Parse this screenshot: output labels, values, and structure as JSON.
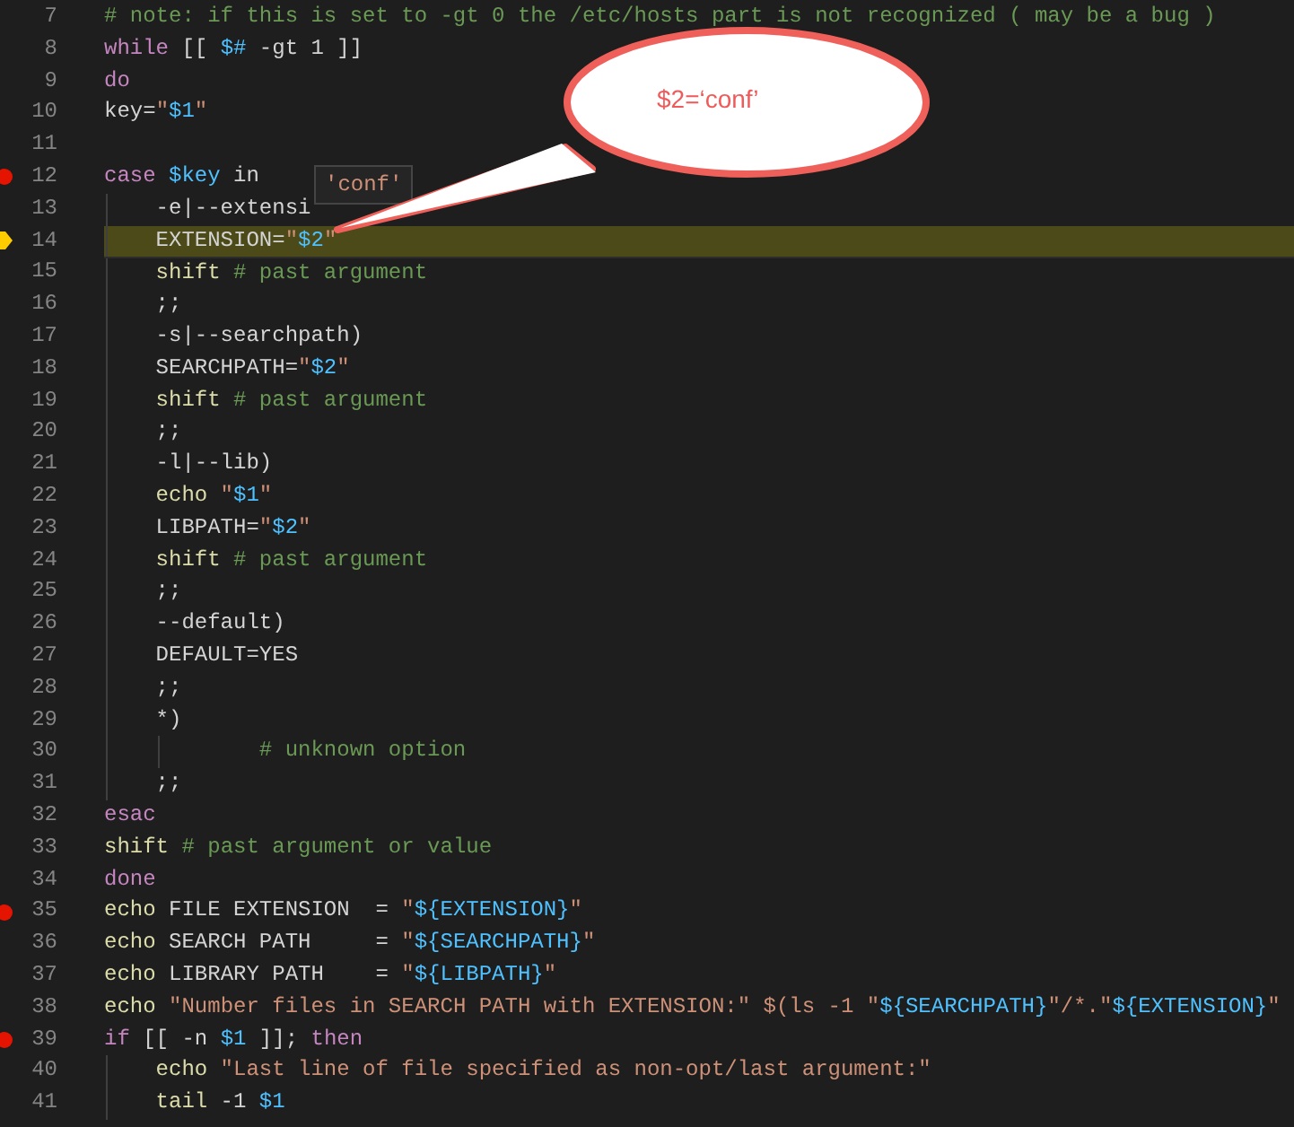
{
  "editor": {
    "lines": [
      {
        "number": "7",
        "breakpoint": false,
        "current": false,
        "segments": [
          {
            "kind": "comment",
            "text": "# note: if this is set to -gt 0 the /etc/hosts part is not recognized ( may be a bug )"
          }
        ]
      },
      {
        "number": "8",
        "breakpoint": false,
        "current": false,
        "segments": [
          {
            "kind": "keyword",
            "text": "while"
          },
          {
            "kind": "plain",
            "text": " [[ "
          },
          {
            "kind": "variable",
            "text": "$#"
          },
          {
            "kind": "plain",
            "text": " -gt 1 ]]"
          }
        ]
      },
      {
        "number": "9",
        "breakpoint": false,
        "current": false,
        "segments": [
          {
            "kind": "keyword",
            "text": "do"
          }
        ]
      },
      {
        "number": "10",
        "breakpoint": false,
        "current": false,
        "segments": [
          {
            "kind": "plain",
            "text": "key="
          },
          {
            "kind": "string",
            "text": "\""
          },
          {
            "kind": "variable",
            "text": "$1"
          },
          {
            "kind": "string",
            "text": "\""
          }
        ]
      },
      {
        "number": "11",
        "breakpoint": false,
        "current": false
      },
      {
        "number": "12",
        "breakpoint": true,
        "current": false,
        "segments": [
          {
            "kind": "keyword",
            "text": "case"
          },
          {
            "kind": "variable",
            "text": " $key"
          },
          {
            "kind": "plain",
            "text": " in"
          }
        ]
      },
      {
        "number": "13",
        "breakpoint": false,
        "current": false,
        "segments": [
          {
            "kind": "plain",
            "text": "    -e|--extensi"
          }
        ]
      },
      {
        "number": "14",
        "breakpoint": false,
        "current": true,
        "segments": [
          {
            "kind": "plain",
            "text": "    EXTENSION="
          },
          {
            "kind": "string",
            "text": "\""
          },
          {
            "kind": "variable",
            "text": "$2"
          },
          {
            "kind": "string",
            "text": "\""
          }
        ]
      },
      {
        "number": "15",
        "breakpoint": false,
        "current": false,
        "segments": [
          {
            "kind": "command",
            "text": "    shift"
          },
          {
            "kind": "comment",
            "text": " # past argument"
          }
        ]
      },
      {
        "number": "16",
        "breakpoint": false,
        "current": false,
        "segments": [
          {
            "kind": "plain",
            "text": "    ;;"
          }
        ]
      },
      {
        "number": "17",
        "breakpoint": false,
        "current": false,
        "segments": [
          {
            "kind": "plain",
            "text": "    -s|--searchpath)"
          }
        ]
      },
      {
        "number": "18",
        "breakpoint": false,
        "current": false,
        "segments": [
          {
            "kind": "plain",
            "text": "    SEARCHPATH="
          },
          {
            "kind": "string",
            "text": "\""
          },
          {
            "kind": "variable",
            "text": "$2"
          },
          {
            "kind": "string",
            "text": "\""
          }
        ]
      },
      {
        "number": "19",
        "breakpoint": false,
        "current": false,
        "segments": [
          {
            "kind": "command",
            "text": "    shift"
          },
          {
            "kind": "comment",
            "text": " # past argument"
          }
        ]
      },
      {
        "number": "20",
        "breakpoint": false,
        "current": false,
        "segments": [
          {
            "kind": "plain",
            "text": "    ;;"
          }
        ]
      },
      {
        "number": "21",
        "breakpoint": false,
        "current": false,
        "segments": [
          {
            "kind": "plain",
            "text": "    -l|--lib)"
          }
        ]
      },
      {
        "number": "22",
        "breakpoint": false,
        "current": false,
        "segments": [
          {
            "kind": "command",
            "text": "    echo"
          },
          {
            "kind": "string",
            "text": " \""
          },
          {
            "kind": "variable",
            "text": "$1"
          },
          {
            "kind": "string",
            "text": "\""
          }
        ]
      },
      {
        "number": "23",
        "breakpoint": false,
        "current": false,
        "segments": [
          {
            "kind": "plain",
            "text": "    LIBPATH="
          },
          {
            "kind": "string",
            "text": "\""
          },
          {
            "kind": "variable",
            "text": "$2"
          },
          {
            "kind": "string",
            "text": "\""
          }
        ]
      },
      {
        "number": "24",
        "breakpoint": false,
        "current": false,
        "segments": [
          {
            "kind": "command",
            "text": "    shift"
          },
          {
            "kind": "comment",
            "text": " # past argument"
          }
        ]
      },
      {
        "number": "25",
        "breakpoint": false,
        "current": false,
        "segments": [
          {
            "kind": "plain",
            "text": "    ;;"
          }
        ]
      },
      {
        "number": "26",
        "breakpoint": false,
        "current": false,
        "segments": [
          {
            "kind": "plain",
            "text": "    --default)"
          }
        ]
      },
      {
        "number": "27",
        "breakpoint": false,
        "current": false,
        "segments": [
          {
            "kind": "plain",
            "text": "    DEFAULT=YES"
          }
        ]
      },
      {
        "number": "28",
        "breakpoint": false,
        "current": false,
        "segments": [
          {
            "kind": "plain",
            "text": "    ;;"
          }
        ]
      },
      {
        "number": "29",
        "breakpoint": false,
        "current": false,
        "segments": [
          {
            "kind": "plain",
            "text": "    *)"
          }
        ]
      },
      {
        "number": "30",
        "breakpoint": false,
        "current": false,
        "segments": [
          {
            "kind": "comment",
            "text": "            # unknown option"
          }
        ]
      },
      {
        "number": "31",
        "breakpoint": false,
        "current": false,
        "segments": [
          {
            "kind": "plain",
            "text": "    ;;"
          }
        ]
      },
      {
        "number": "32",
        "breakpoint": false,
        "current": false,
        "segments": [
          {
            "kind": "keyword",
            "text": "esac"
          }
        ]
      },
      {
        "number": "33",
        "breakpoint": false,
        "current": false,
        "segments": [
          {
            "kind": "command",
            "text": "shift"
          },
          {
            "kind": "comment",
            "text": " # past argument or value"
          }
        ]
      },
      {
        "number": "34",
        "breakpoint": false,
        "current": false,
        "segments": [
          {
            "kind": "keyword",
            "text": "done"
          }
        ]
      },
      {
        "number": "35",
        "breakpoint": true,
        "current": false,
        "segments": [
          {
            "kind": "command",
            "text": "echo"
          },
          {
            "kind": "plain",
            "text": " FILE EXTENSION  = "
          },
          {
            "kind": "string",
            "text": "\""
          },
          {
            "kind": "variable",
            "text": "${EXTENSION}"
          },
          {
            "kind": "string",
            "text": "\""
          }
        ]
      },
      {
        "number": "36",
        "breakpoint": false,
        "current": false,
        "segments": [
          {
            "kind": "command",
            "text": "echo"
          },
          {
            "kind": "plain",
            "text": " SEARCH PATH     = "
          },
          {
            "kind": "string",
            "text": "\""
          },
          {
            "kind": "variable",
            "text": "${SEARCHPATH}"
          },
          {
            "kind": "string",
            "text": "\""
          }
        ]
      },
      {
        "number": "37",
        "breakpoint": false,
        "current": false,
        "segments": [
          {
            "kind": "command",
            "text": "echo"
          },
          {
            "kind": "plain",
            "text": " LIBRARY PATH    = "
          },
          {
            "kind": "string",
            "text": "\""
          },
          {
            "kind": "variable",
            "text": "${LIBPATH}"
          },
          {
            "kind": "string",
            "text": "\""
          }
        ]
      },
      {
        "number": "38",
        "breakpoint": false,
        "current": false,
        "segments": [
          {
            "kind": "command",
            "text": "echo"
          },
          {
            "kind": "string",
            "text": " \"Number files in SEARCH PATH with EXTENSION:\" $(ls -1 \""
          },
          {
            "kind": "variable",
            "text": "${SEARCHPATH}"
          },
          {
            "kind": "string",
            "text": "\"/*.\""
          },
          {
            "kind": "variable",
            "text": "${EXTENSION}"
          },
          {
            "kind": "string",
            "text": "\""
          }
        ]
      },
      {
        "number": "39",
        "breakpoint": true,
        "current": false,
        "segments": [
          {
            "kind": "keyword",
            "text": "if"
          },
          {
            "kind": "plain",
            "text": " [[ -n "
          },
          {
            "kind": "variable",
            "text": "$1"
          },
          {
            "kind": "plain",
            "text": " ]]; "
          },
          {
            "kind": "keyword",
            "text": "then"
          }
        ]
      },
      {
        "number": "40",
        "breakpoint": false,
        "current": false,
        "segments": [
          {
            "kind": "command",
            "text": "    echo"
          },
          {
            "kind": "string",
            "text": " \"Last line of file specified as non-opt/last argument:\""
          }
        ]
      },
      {
        "number": "41",
        "breakpoint": false,
        "current": false,
        "segments": [
          {
            "kind": "command",
            "text": "    tail"
          },
          {
            "kind": "plain",
            "text": " -1 "
          },
          {
            "kind": "variable",
            "text": "$1"
          }
        ]
      }
    ]
  },
  "hover": {
    "text": "'conf'"
  },
  "callout": {
    "text": "$2=‘conf’"
  }
}
